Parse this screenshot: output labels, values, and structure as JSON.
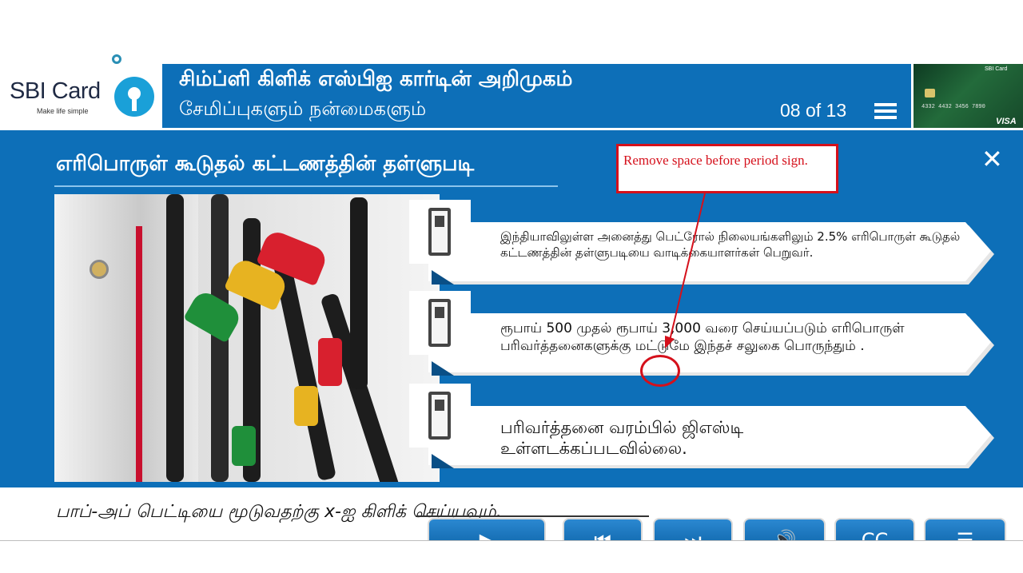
{
  "logo": {
    "name": "SBI Card",
    "tagline": "Make life simple"
  },
  "header": {
    "title": "சிம்ப்ளி கிளிக் எஸ்பிஐ கார்டின் அறிமுகம்",
    "subtitle": "சேமிப்புகளும் நன்மைகளும்",
    "page_indicator": "08 of 13",
    "card_image": {
      "brand": "SBI Card",
      "number": "4332 4432 3456 7890",
      "network": "VISA"
    }
  },
  "panel": {
    "title": "எரிபொருள் கூடுதல் கட்டணத்தின் தள்ளுபடி",
    "close_icon": "close-icon",
    "items": [
      {
        "icon": "fuel-pump-icon",
        "text": "இந்தியாவிலுள்ள அனைத்து பெட்ரோல் நிலையங்களிலும் 2.5% எரிபொருள் கூடுதல் கட்டணத்தின் தள்ளுபடியை வாடிக்கையாளர்கள் பெறுவர்."
      },
      {
        "icon": "fuel-pump-icon",
        "text": "ரூபாய் 500 முதல் ரூபாய் 3,000 வரை செய்யப்படும் எரிபொருள் பரிவர்த்தனைகளுக்கு மட்டுமே இந்தச் சலுகை பொருந்தும் ."
      },
      {
        "icon": "fuel-pump-icon",
        "text": "பரிவர்த்தனை வரம்பில் ஜிஎஸ்டி உள்ளடக்கப்படவில்லை."
      }
    ]
  },
  "annotation": {
    "text": "Remove space before period sign.",
    "color": "#d5101b"
  },
  "footer": {
    "instruction": "பாப்-அப் பெட்டியை மூடுவதற்கு x-ஐ கிளிக் செய்யவும்.",
    "buttons": [
      {
        "name": "play-button",
        "icon": "play-icon"
      },
      {
        "name": "previous-button",
        "icon": "previous-icon"
      },
      {
        "name": "next-button",
        "icon": "next-icon"
      },
      {
        "name": "audio-button",
        "icon": "speaker-icon"
      },
      {
        "name": "captions-button",
        "icon": "captions-icon"
      },
      {
        "name": "menu-button",
        "icon": "menu-icon"
      }
    ]
  },
  "colors": {
    "brand_blue": "#0d6fb8",
    "logo_blue": "#1aa0d8",
    "annotation_red": "#d5101b"
  }
}
